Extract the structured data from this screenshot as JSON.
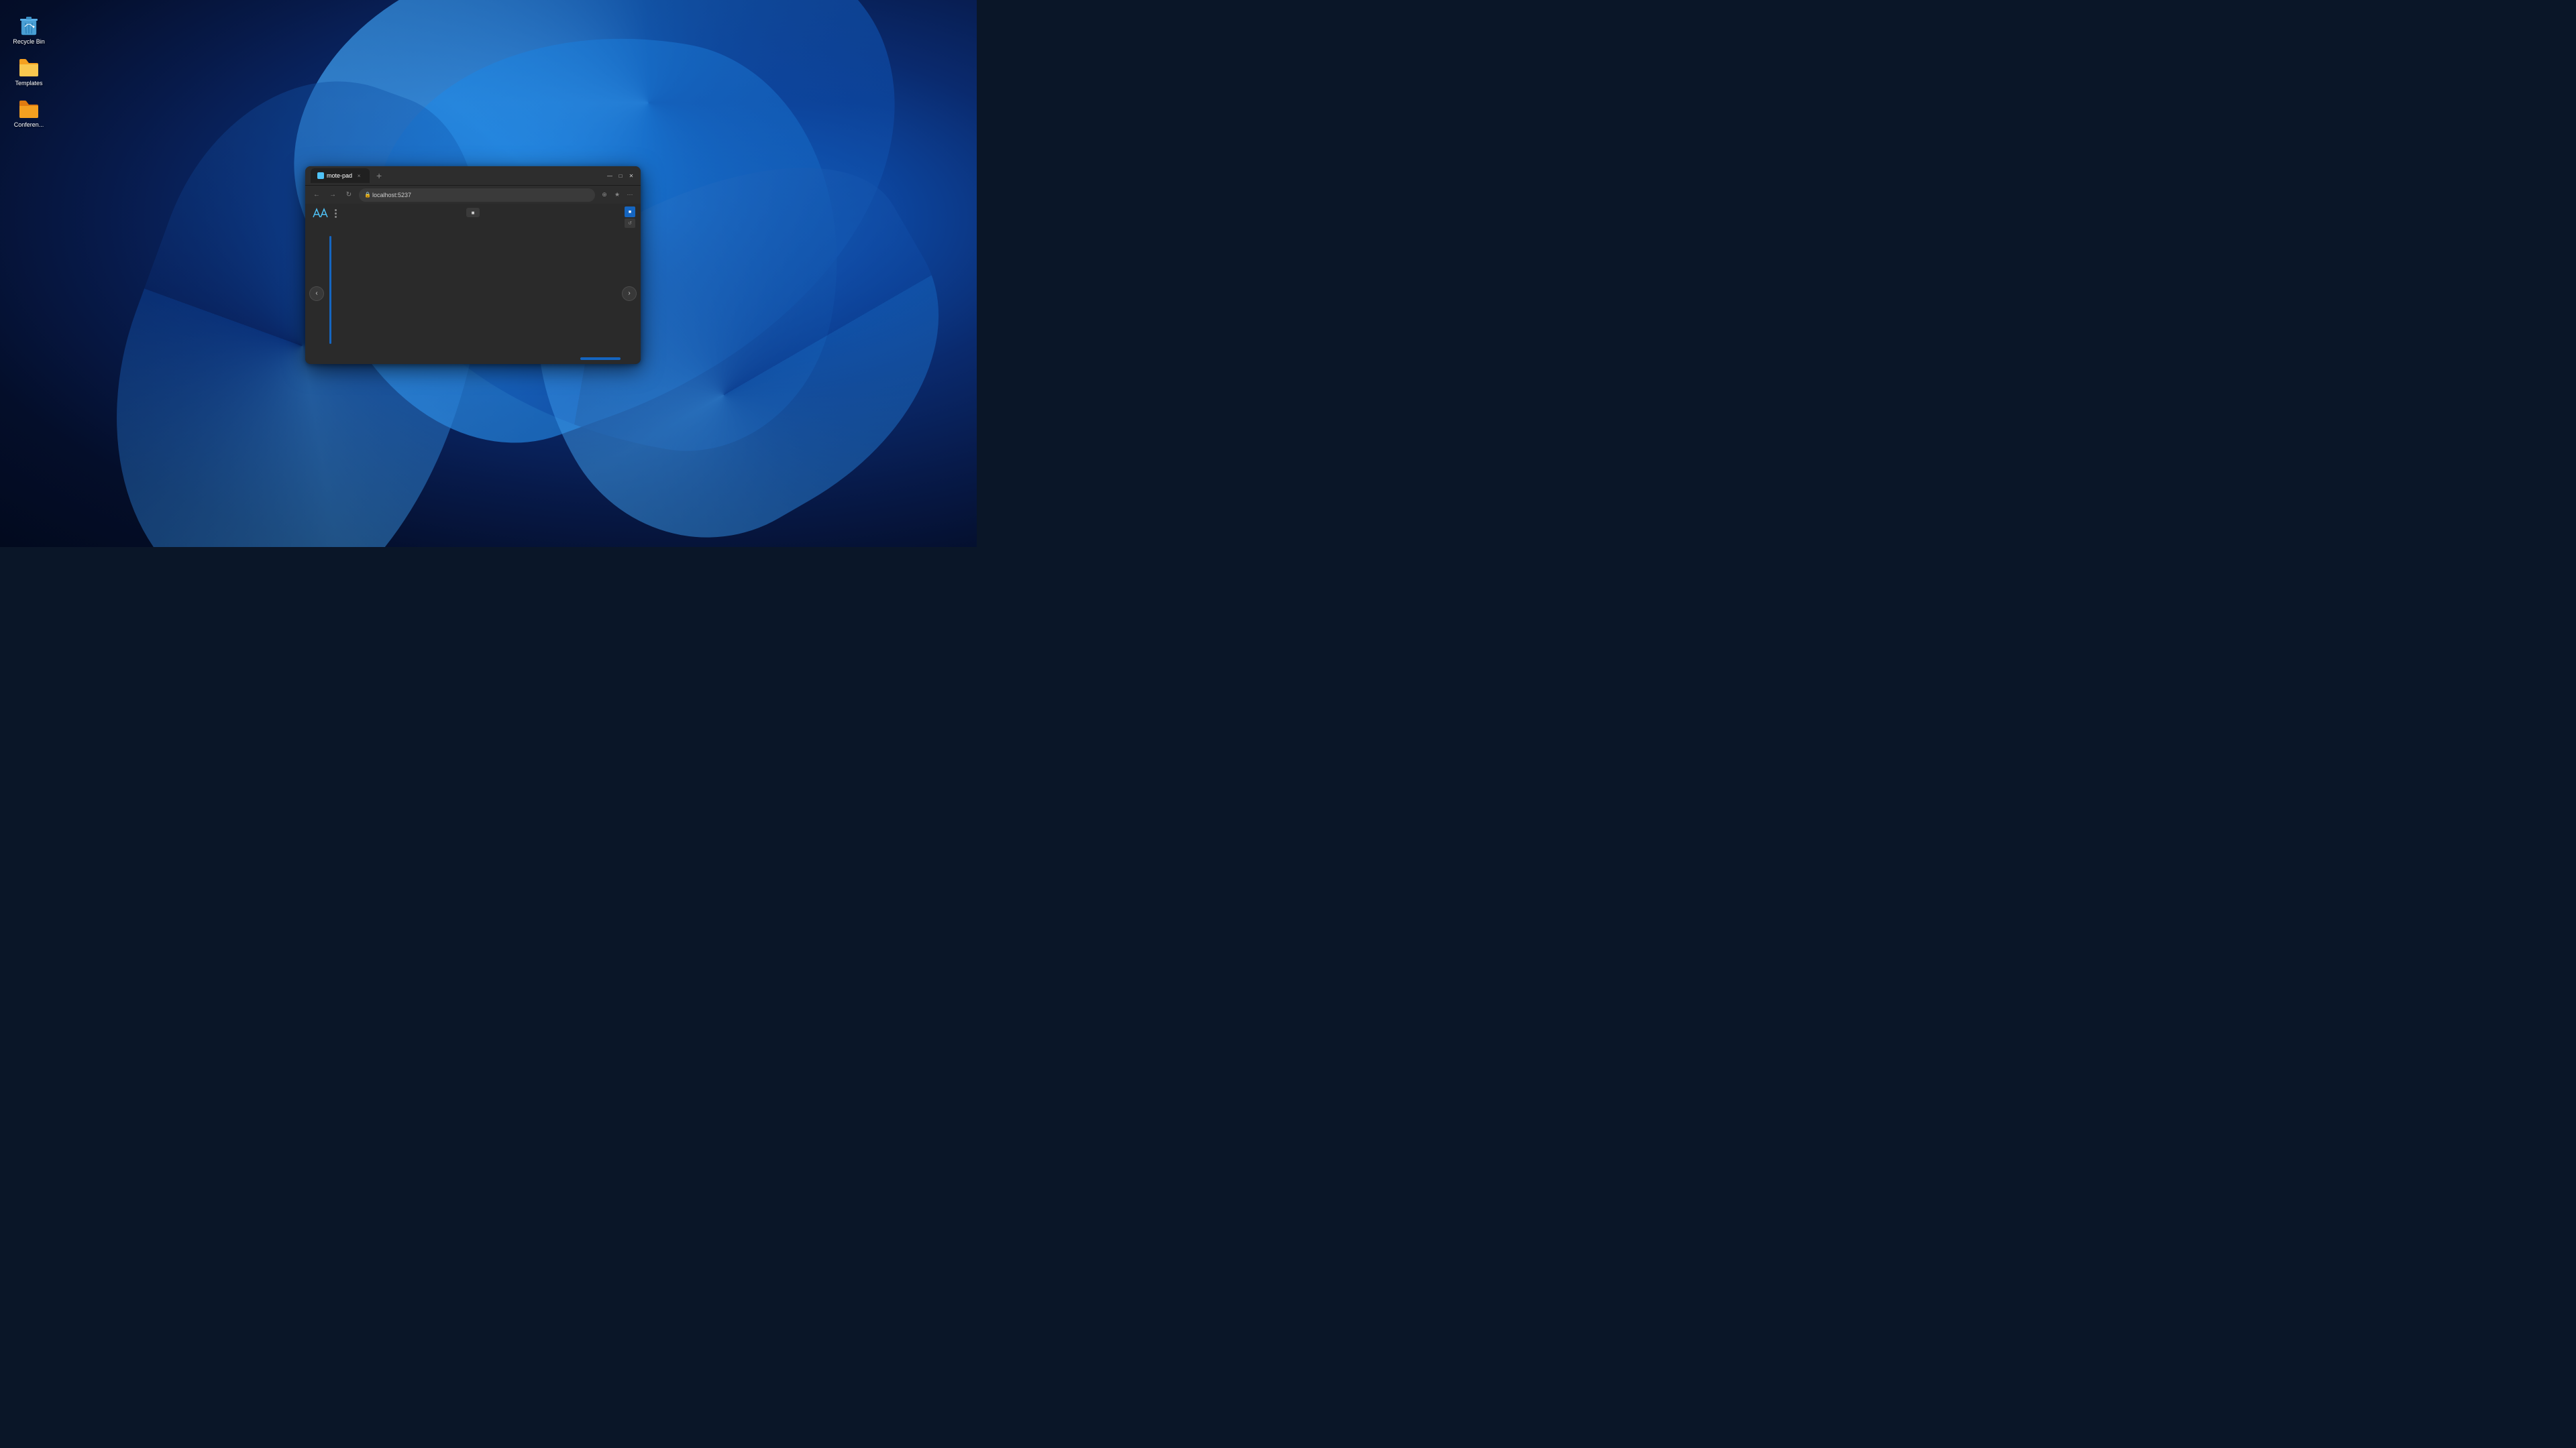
{
  "wallpaper": {
    "alt": "Windows 11 blue wave wallpaper"
  },
  "desktop": {
    "icons": [
      {
        "id": "recycle-bin",
        "label": "Recycle Bin",
        "type": "recycle-bin"
      },
      {
        "id": "templates",
        "label": "Templates",
        "type": "folder"
      },
      {
        "id": "conferences",
        "label": "Conferen...",
        "type": "folder"
      }
    ]
  },
  "browser": {
    "title": "mote-pad",
    "tab_label": "mote-pad",
    "url": "localhost:5237",
    "window_controls": {
      "minimize": "—",
      "maximize": "□",
      "close": "✕"
    },
    "nav": {
      "back": "←",
      "forward": "→",
      "refresh": "↻"
    }
  },
  "app": {
    "logo_text": "AA",
    "left_arrow": "‹",
    "right_arrow": "›",
    "transport_label": "■",
    "right_btn_1": "■",
    "right_btn_2": "↺",
    "sidebar_menu": "≡"
  }
}
